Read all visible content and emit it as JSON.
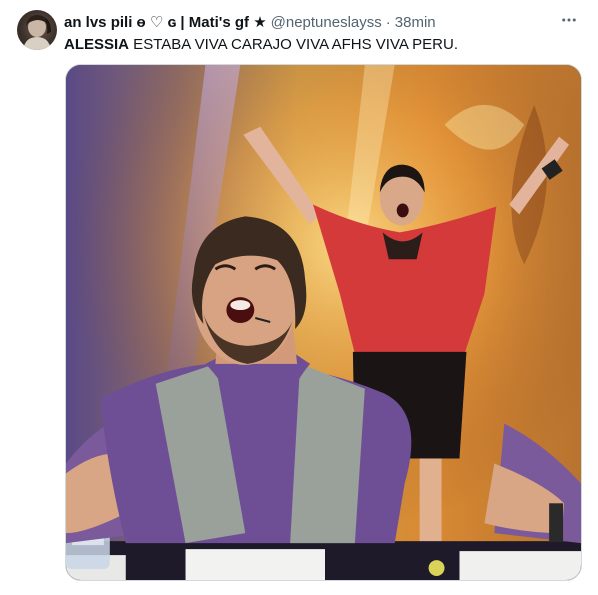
{
  "tweet": {
    "display_name": "an lvs pili ɵ ♡ ɢ | Mati's gf ★",
    "handle": "@neptuneslayss",
    "separator": "·",
    "time": "38min",
    "text": {
      "mention": "ALESSIA",
      "body": " ESTABA VIVA CARAJO VIVA AFHS VIVA PERU."
    },
    "icons": {
      "more": "more-horizontal-icon"
    }
  },
  "colors": {
    "text_primary": "#0f1419",
    "text_secondary": "#536471",
    "media_border": "#cfd9de"
  }
}
